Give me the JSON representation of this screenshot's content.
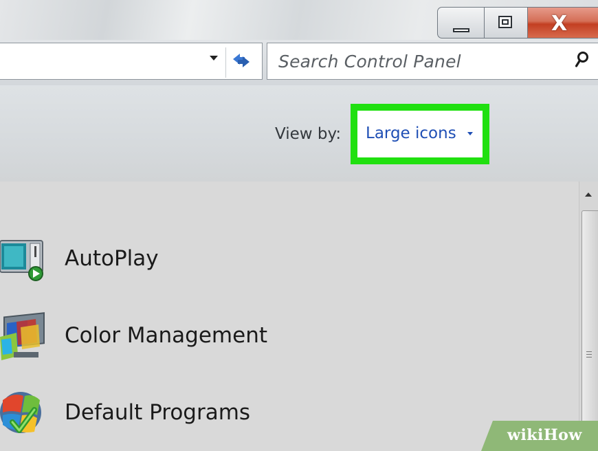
{
  "window": {
    "buttons": {
      "minimize": "minimize-icon",
      "maximize": "restore-icon",
      "close": "X"
    }
  },
  "toolbar": {
    "address_dropdown_icon": "chevron-down-icon",
    "refresh_icon": "refresh-icon",
    "search": {
      "placeholder": "Search Control Panel",
      "icon": "search-icon"
    }
  },
  "view_by": {
    "label": "View by:",
    "value": "Large icons",
    "highlight_color": "#20e010"
  },
  "items": [
    {
      "label": "AutoPlay",
      "icon": "autoplay-icon"
    },
    {
      "label": "Color Management",
      "icon": "color-management-icon"
    },
    {
      "label": "Default Programs",
      "icon": "default-programs-icon"
    }
  ],
  "watermark": {
    "text": "wikiHow"
  }
}
